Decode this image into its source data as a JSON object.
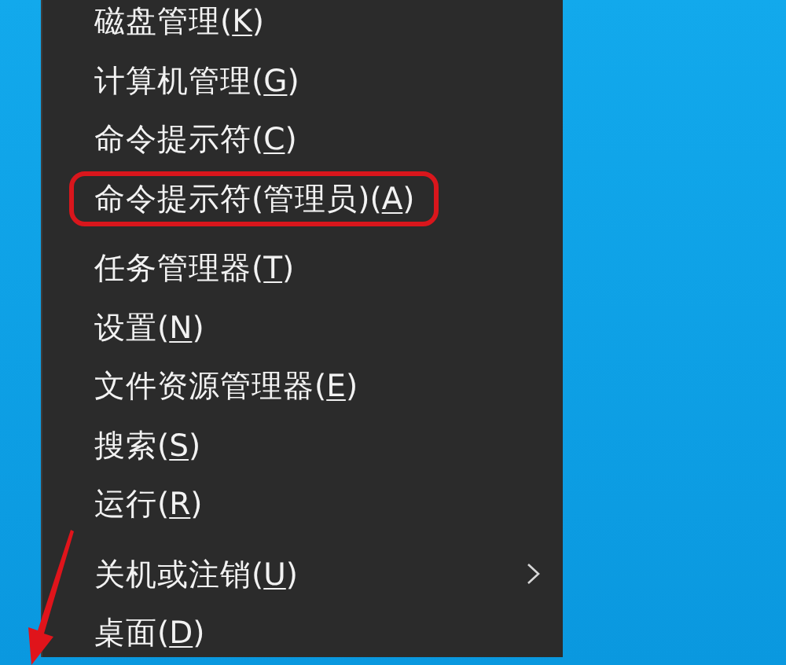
{
  "menu": {
    "groups": [
      {
        "items": [
          {
            "text_before": "磁盘管理(",
            "access_key": "K",
            "text_after": ")",
            "has_submenu": false,
            "annotated": false
          },
          {
            "text_before": "计算机管理(",
            "access_key": "G",
            "text_after": ")",
            "has_submenu": false,
            "annotated": false
          },
          {
            "text_before": "命令提示符(",
            "access_key": "C",
            "text_after": ")",
            "has_submenu": false,
            "annotated": false
          },
          {
            "text_before": "命令提示符(管理员)(",
            "access_key": "A",
            "text_after": ")",
            "has_submenu": false,
            "annotated": true
          }
        ]
      },
      {
        "items": [
          {
            "text_before": "任务管理器(",
            "access_key": "T",
            "text_after": ")",
            "has_submenu": false,
            "annotated": false
          },
          {
            "text_before": "设置(",
            "access_key": "N",
            "text_after": ")",
            "has_submenu": false,
            "annotated": false
          },
          {
            "text_before": "文件资源管理器(",
            "access_key": "E",
            "text_after": ")",
            "has_submenu": false,
            "annotated": false
          },
          {
            "text_before": "搜索(",
            "access_key": "S",
            "text_after": ")",
            "has_submenu": false,
            "annotated": false
          },
          {
            "text_before": "运行(",
            "access_key": "R",
            "text_after": ")",
            "has_submenu": false,
            "annotated": false
          }
        ]
      },
      {
        "items": [
          {
            "text_before": "关机或注销(",
            "access_key": "U",
            "text_after": ")",
            "has_submenu": true,
            "annotated": false
          },
          {
            "text_before": "桌面(",
            "access_key": "D",
            "text_after": ")",
            "has_submenu": false,
            "annotated": false
          }
        ]
      }
    ]
  }
}
